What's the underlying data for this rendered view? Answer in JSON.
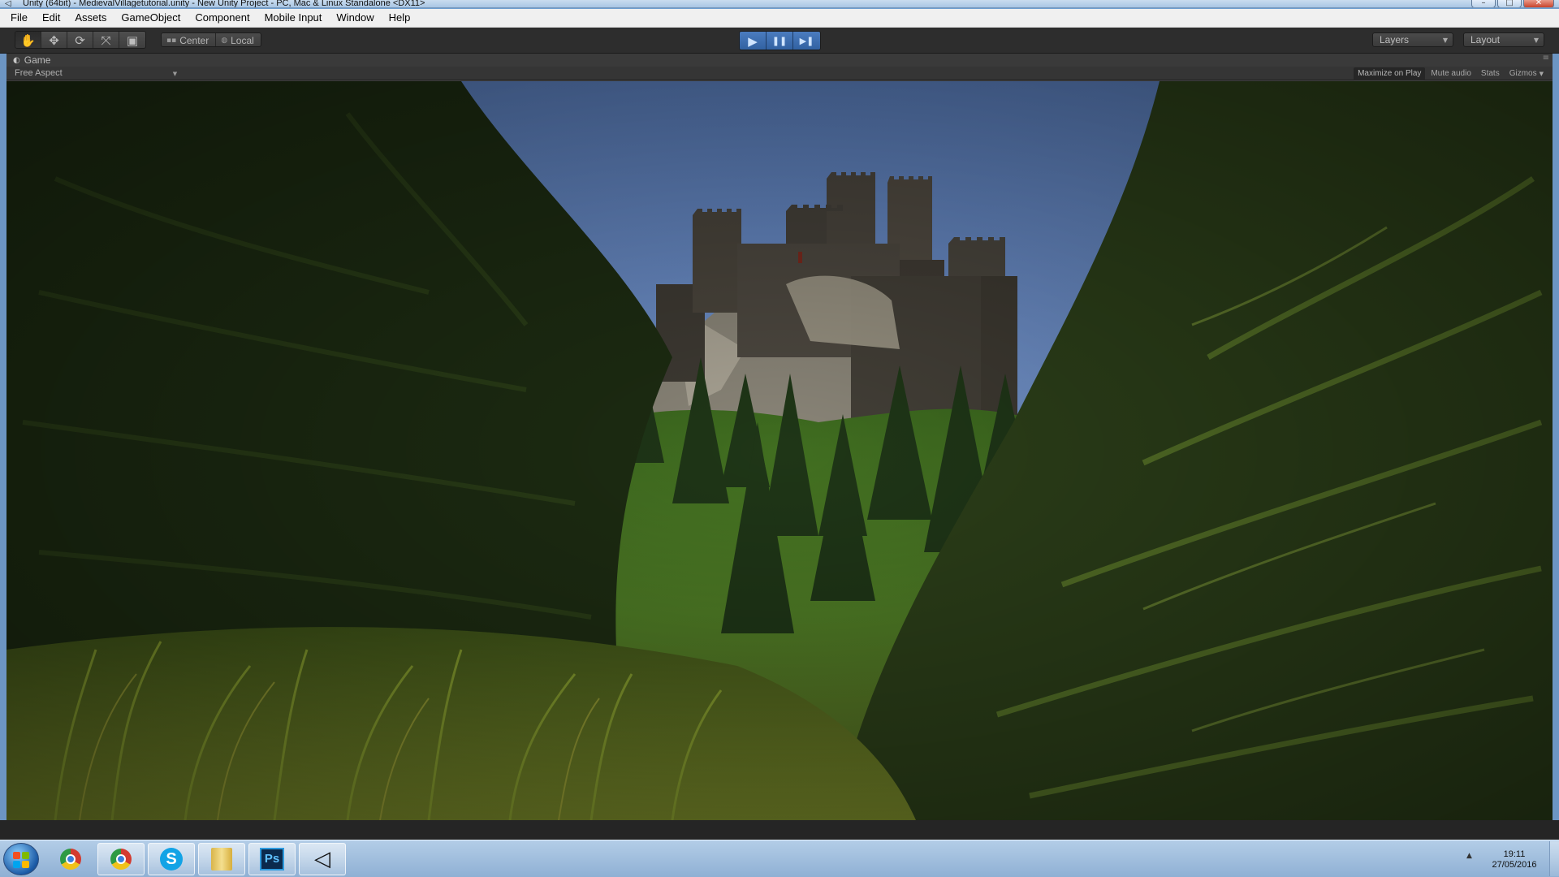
{
  "window": {
    "title": "Unity (64bit) - MedievalVillagetutorial.unity - New Unity Project - PC, Mac & Linux Standalone <DX11>",
    "icon": "unity-icon",
    "controls": {
      "minimize": "–",
      "maximize": "□",
      "close": "✕"
    }
  },
  "menu": [
    "File",
    "Edit",
    "Assets",
    "GameObject",
    "Component",
    "Mobile Input",
    "Window",
    "Help"
  ],
  "toolbar": {
    "tools": [
      {
        "name": "hand-tool-icon",
        "glyph": "✋"
      },
      {
        "name": "move-tool-icon",
        "glyph": "✥"
      },
      {
        "name": "rotate-tool-icon",
        "glyph": "⟳"
      },
      {
        "name": "scale-tool-icon",
        "glyph": "⤧"
      },
      {
        "name": "rect-tool-icon",
        "glyph": "▣"
      }
    ],
    "pivot": "Center",
    "space": "Local",
    "play": {
      "play": "▶",
      "pause": "❚❚",
      "step": "▶❚"
    },
    "layers": "Layers",
    "layout": "Layout"
  },
  "game_panel": {
    "tab": "Game",
    "aspect": "Free Aspect",
    "options": [
      "Maximize on Play",
      "Mute audio",
      "Stats",
      "Gizmos"
    ]
  },
  "taskbar": {
    "apps": [
      "chrome-icon",
      "chrome-icon",
      "skype-icon",
      "folder-icon",
      "photoshop-icon",
      "unity-icon"
    ],
    "photoshop_label": "Ps",
    "skype_label": "S",
    "unity_glyph": "◁",
    "time": "19:11",
    "date": "27/05/2016"
  },
  "colors": {
    "unity_dark": "#3f3f3f",
    "toolbar": "#2d2d2d",
    "play_blue": "#3a6db0",
    "sky": "#6d8fc6",
    "foliage": "#2f4a1c",
    "castle": "#4c4840"
  }
}
